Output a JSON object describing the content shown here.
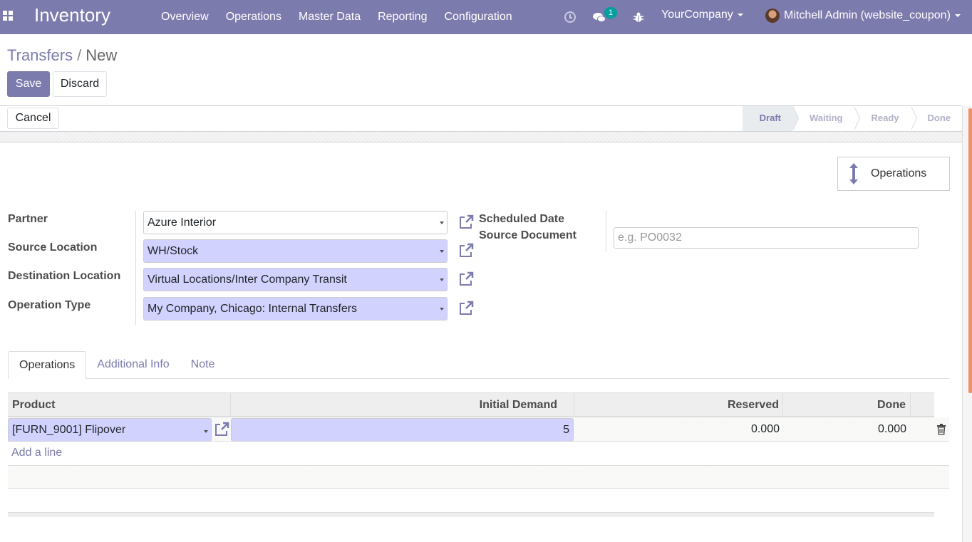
{
  "navbar": {
    "app_name": "Inventory",
    "menu": [
      "Overview",
      "Operations",
      "Master Data",
      "Reporting",
      "Configuration"
    ],
    "message_count": "1",
    "company": "YourCompany",
    "user": "Mitchell Admin (website_coupon)",
    "bg_color": "#7c7bad"
  },
  "breadcrumb": {
    "parent": "Transfers",
    "separator": "/",
    "current": "New"
  },
  "buttons": {
    "save": "Save",
    "discard": "Discard",
    "cancel": "Cancel"
  },
  "status": {
    "stages": [
      "Draft",
      "Waiting",
      "Ready",
      "Done"
    ],
    "active": "Draft"
  },
  "smart_button": {
    "label": "Operations"
  },
  "form": {
    "partner_label": "Partner",
    "partner_value": "Azure Interior",
    "source_location_label": "Source Location",
    "source_location_value": "WH/Stock",
    "destination_location_label": "Destination Location",
    "destination_location_value": "Virtual Locations/Inter Company Transit",
    "operation_type_label": "Operation Type",
    "operation_type_value": "My Company, Chicago: Internal Transfers",
    "scheduled_date_label": "Scheduled Date",
    "source_document_label": "Source Document",
    "source_document_placeholder": "e.g. PO0032",
    "source_document_value": ""
  },
  "tabs": [
    "Operations",
    "Additional Info",
    "Note"
  ],
  "table": {
    "columns": [
      "Product",
      "Initial Demand",
      "Reserved",
      "Done"
    ],
    "rows": [
      {
        "product": "[FURN_9001] Flipover",
        "initial_demand": "5",
        "reserved": "0.000",
        "done": "0.000"
      }
    ],
    "add_line": "Add a line"
  }
}
